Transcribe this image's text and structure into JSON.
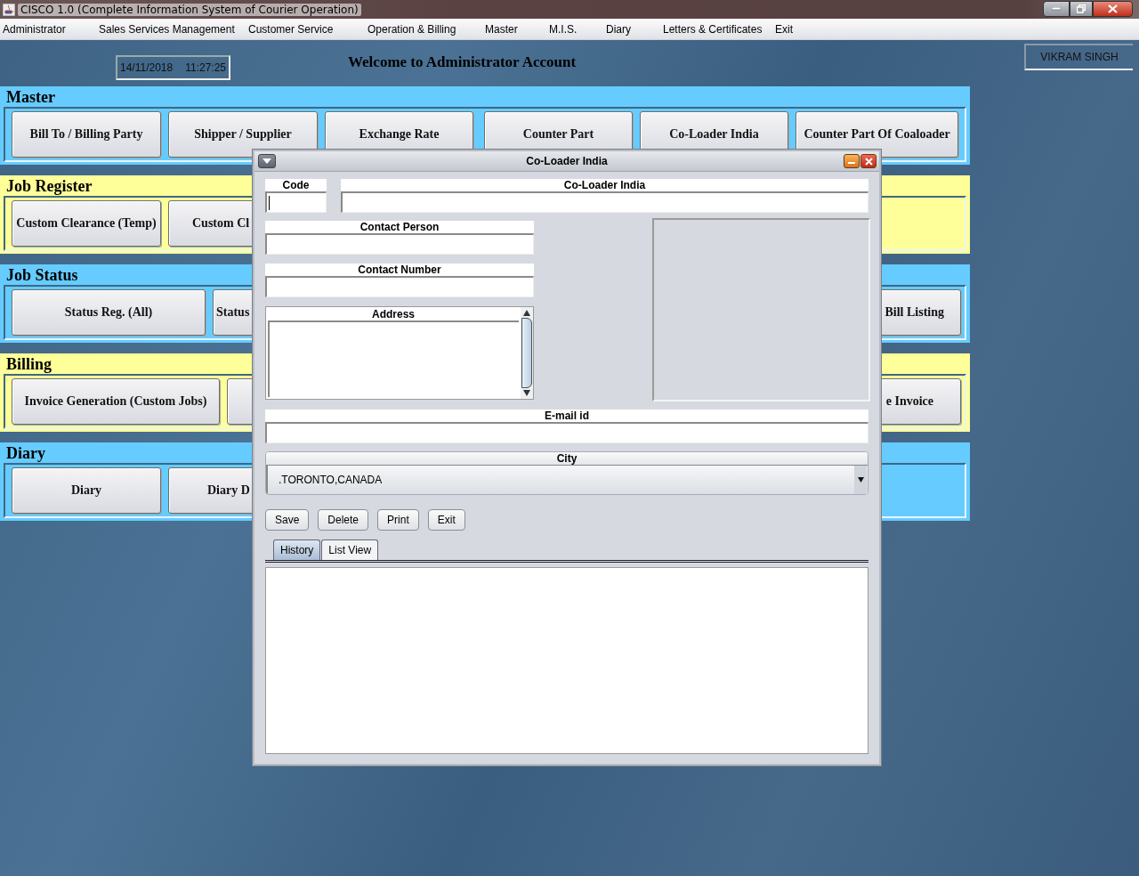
{
  "window": {
    "title": "CISCO 1.0 (Complete Information System of Courier Operation)"
  },
  "menu": [
    {
      "label": "Administrator"
    },
    {
      "label": "Sales Services Management"
    },
    {
      "label": "Customer Service"
    },
    {
      "label": "Operation & Billing"
    },
    {
      "label": "Master"
    },
    {
      "label": "M.I.S."
    },
    {
      "label": "Diary"
    },
    {
      "label": "Letters & Certificates"
    },
    {
      "label": "Exit"
    }
  ],
  "header": {
    "date": "14/11/2018",
    "time": "11:27:25",
    "welcome": "Welcome to Administrator Account",
    "user": "VIKRAM SINGH"
  },
  "sections": [
    {
      "title": "Master",
      "color": "#66ccff",
      "buttons": [
        {
          "kind": "button",
          "label": "Bill To / Billing Party"
        },
        {
          "kind": "button",
          "label": "Shipper / Supplier"
        },
        {
          "kind": "button",
          "label": "Exchange Rate"
        },
        {
          "kind": "button",
          "label": "Counter Part"
        },
        {
          "kind": "button",
          "label": "Co-Loader India"
        },
        {
          "kind": "button",
          "label": "Counter Part Of Coaloader"
        }
      ]
    },
    {
      "title": "Job Register",
      "color": "#ffff99",
      "buttons": [
        {
          "kind": "button",
          "label": "Custom Clearance (Temp)"
        },
        {
          "kind": "button",
          "label": "Custom Cl"
        }
      ]
    },
    {
      "title": "Job Status",
      "color": "#66ccff",
      "buttons": [
        {
          "kind": "button",
          "label": "Status Reg. (All)"
        },
        {
          "kind": "button",
          "label": "Status"
        },
        {
          "kind": "tail",
          "label": "Bill Listing"
        }
      ]
    },
    {
      "title": "Billing",
      "color": "#ffff99",
      "buttons": [
        {
          "kind": "button",
          "label": "Invoice Generation (Custom Jobs)"
        },
        {
          "kind": "button"
        },
        {
          "kind": "tail",
          "label": "e Invoice"
        }
      ]
    },
    {
      "title": "Diary",
      "color": "#66ccff",
      "buttons": [
        {
          "kind": "button",
          "label": "Diary"
        },
        {
          "kind": "button",
          "label": "Diary D"
        }
      ]
    }
  ],
  "dialog": {
    "title": "Co-Loader India",
    "code": {
      "label": "Code",
      "focused": true
    },
    "name": {
      "label": "Co-Loader India"
    },
    "contact_person": {
      "label": "Contact Person"
    },
    "contact_number": {
      "label": "Contact Number"
    },
    "address": {
      "label": "Address"
    },
    "email": {
      "label": "E-mail id"
    },
    "city": {
      "label": "City",
      "value": ".TORONTO,CANADA"
    },
    "buttons": [
      {
        "label": "Save"
      },
      {
        "label": "Delete"
      },
      {
        "label": "Print"
      },
      {
        "label": "Exit"
      }
    ],
    "tabs": [
      {
        "label": "History",
        "selected": true
      },
      {
        "label": "List View",
        "selected": false
      }
    ]
  }
}
